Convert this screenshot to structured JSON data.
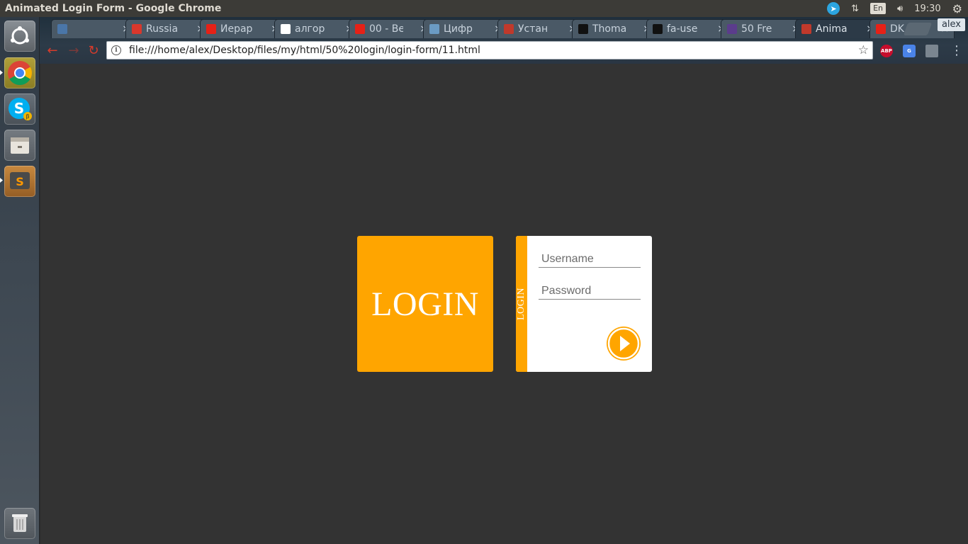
{
  "top_panel": {
    "window_title": "Animated Login Form - Google Chrome",
    "lang": "En",
    "time": "19:30"
  },
  "launcher": {
    "items": [
      "dash-home",
      "chrome",
      "skype",
      "files",
      "sublime-text",
      "trash"
    ]
  },
  "browser": {
    "tabs": [
      {
        "label": "",
        "icon": "vk-icon",
        "color": "#4a76a8"
      },
      {
        "label": "Russia",
        "icon": "dx-icon",
        "color": "#d9372c"
      },
      {
        "label": "Иерар",
        "icon": "youtube-icon",
        "color": "#e62117"
      },
      {
        "label": "алгор",
        "icon": "google-icon",
        "color": "#ffffff"
      },
      {
        "label": "00 - Ве",
        "icon": "youtube-icon",
        "color": "#e62117"
      },
      {
        "label": "Цифр",
        "icon": "h-icon",
        "color": "#6b9bc3"
      },
      {
        "label": "Устан",
        "icon": "ruby-icon",
        "color": "#c0392b"
      },
      {
        "label": "Thoma",
        "icon": "github-icon",
        "color": "#111111"
      },
      {
        "label": "fa-use",
        "icon": "flag-icon",
        "color": "#111111"
      },
      {
        "label": "50 Fre",
        "icon": "colorlib-icon",
        "color": "#5b3c8c"
      },
      {
        "label": "Anima",
        "icon": "loading-icon",
        "color": "#c0392b"
      },
      {
        "label": "DK -",
        "icon": "youtube-icon",
        "color": "#e62117"
      }
    ],
    "active_tab_index": 10,
    "profile": "alex",
    "url": "file:///home/alex/Desktop/files/my/html/50%20login/login-form/11.html",
    "extensions": [
      {
        "name": "adblock-plus-icon",
        "text": "ABP",
        "color": "#c70d2c"
      },
      {
        "name": "google-translate-icon",
        "text": "G",
        "color": "#4a83e8"
      },
      {
        "name": "color-picker-icon",
        "text": "",
        "color": "#7b8690"
      }
    ]
  },
  "page": {
    "tile_title": "LOGIN",
    "strip_label": "LOGIN",
    "username_placeholder": "Username",
    "password_placeholder": "Password",
    "submit_icon": "play-arrow-icon",
    "accent_color": "#ffa500",
    "background_color": "#333333"
  }
}
